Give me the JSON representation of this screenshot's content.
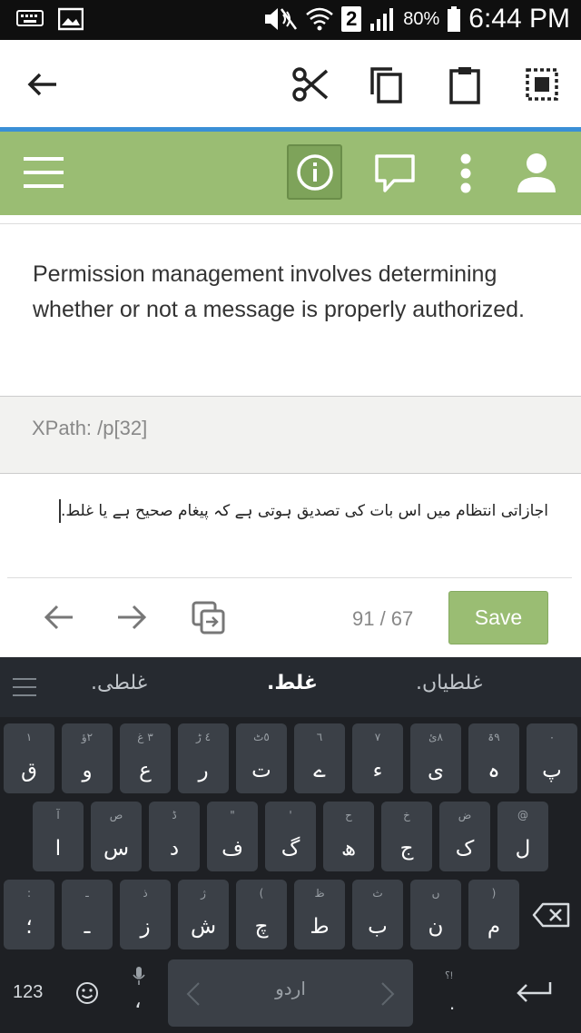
{
  "status_bar": {
    "battery": "80%",
    "time": "6:44 PM",
    "sim_badge": "2"
  },
  "action_bar": {
    "icons": [
      "back-arrow-icon",
      "cut-icon",
      "copy-icon",
      "paste-icon",
      "select-all-icon"
    ]
  },
  "toolbar": {
    "icons": [
      "menu-icon",
      "info-icon",
      "comment-icon",
      "more-vert-icon",
      "account-icon"
    ],
    "colors": {
      "bar": "#9abd73",
      "active": "#7ea35a"
    }
  },
  "source": {
    "text": "Permission management involves determining whether or not a message is properly authorized."
  },
  "xpath": {
    "text": "XPath: /p[32]"
  },
  "target": {
    "text": "اجازاتی انتظام میں اس بات کی تصدیق ہوتی ہے کہ پیغام صحیح ہے یا غلط."
  },
  "navigation": {
    "count": "91 / 67",
    "save_label": "Save"
  },
  "keyboard": {
    "suggestions": [
      "غلطی.",
      "غلط.",
      "غلطیاں."
    ],
    "row1": [
      {
        "main": "ق",
        "hint": "١"
      },
      {
        "main": "و",
        "hint": "٢ؤ"
      },
      {
        "main": "ع",
        "hint": "٣ غ"
      },
      {
        "main": "ر",
        "hint": "٤ ڑ"
      },
      {
        "main": "ت",
        "hint": "٥ٹ"
      },
      {
        "main": "ے",
        "hint": "٦"
      },
      {
        "main": "ء",
        "hint": "٧"
      },
      {
        "main": "ی",
        "hint": "٨ئ"
      },
      {
        "main": "ہ",
        "hint": "٩ۃ"
      },
      {
        "main": "پ",
        "hint": "٠"
      }
    ],
    "row2": [
      {
        "main": "ا",
        "hint": "آ"
      },
      {
        "main": "س",
        "hint": "ص"
      },
      {
        "main": "د",
        "hint": "ڈ"
      },
      {
        "main": "ف",
        "hint": "\""
      },
      {
        "main": "گ",
        "hint": "'"
      },
      {
        "main": "ھ",
        "hint": "ح"
      },
      {
        "main": "ج",
        "hint": "خ"
      },
      {
        "main": "ک",
        "hint": "ض"
      },
      {
        "main": "ل",
        "hint": "@"
      }
    ],
    "row3": [
      {
        "main": "؛",
        "hint": ":"
      },
      {
        "main": "ـ",
        "hint": "ـ"
      },
      {
        "main": "ز",
        "hint": "ذ"
      },
      {
        "main": "ش",
        "hint": "ژ"
      },
      {
        "main": "چ",
        "hint": "("
      },
      {
        "main": "ط",
        "hint": "ظ"
      },
      {
        "main": "ب",
        "hint": "ث"
      },
      {
        "main": "ن",
        "hint": "ں"
      },
      {
        "main": "م",
        "hint": ")"
      }
    ],
    "numbers_key": "123",
    "comma_key": "،",
    "space_label": "اردو",
    "period_key": ".",
    "period_hint": "؟!"
  }
}
